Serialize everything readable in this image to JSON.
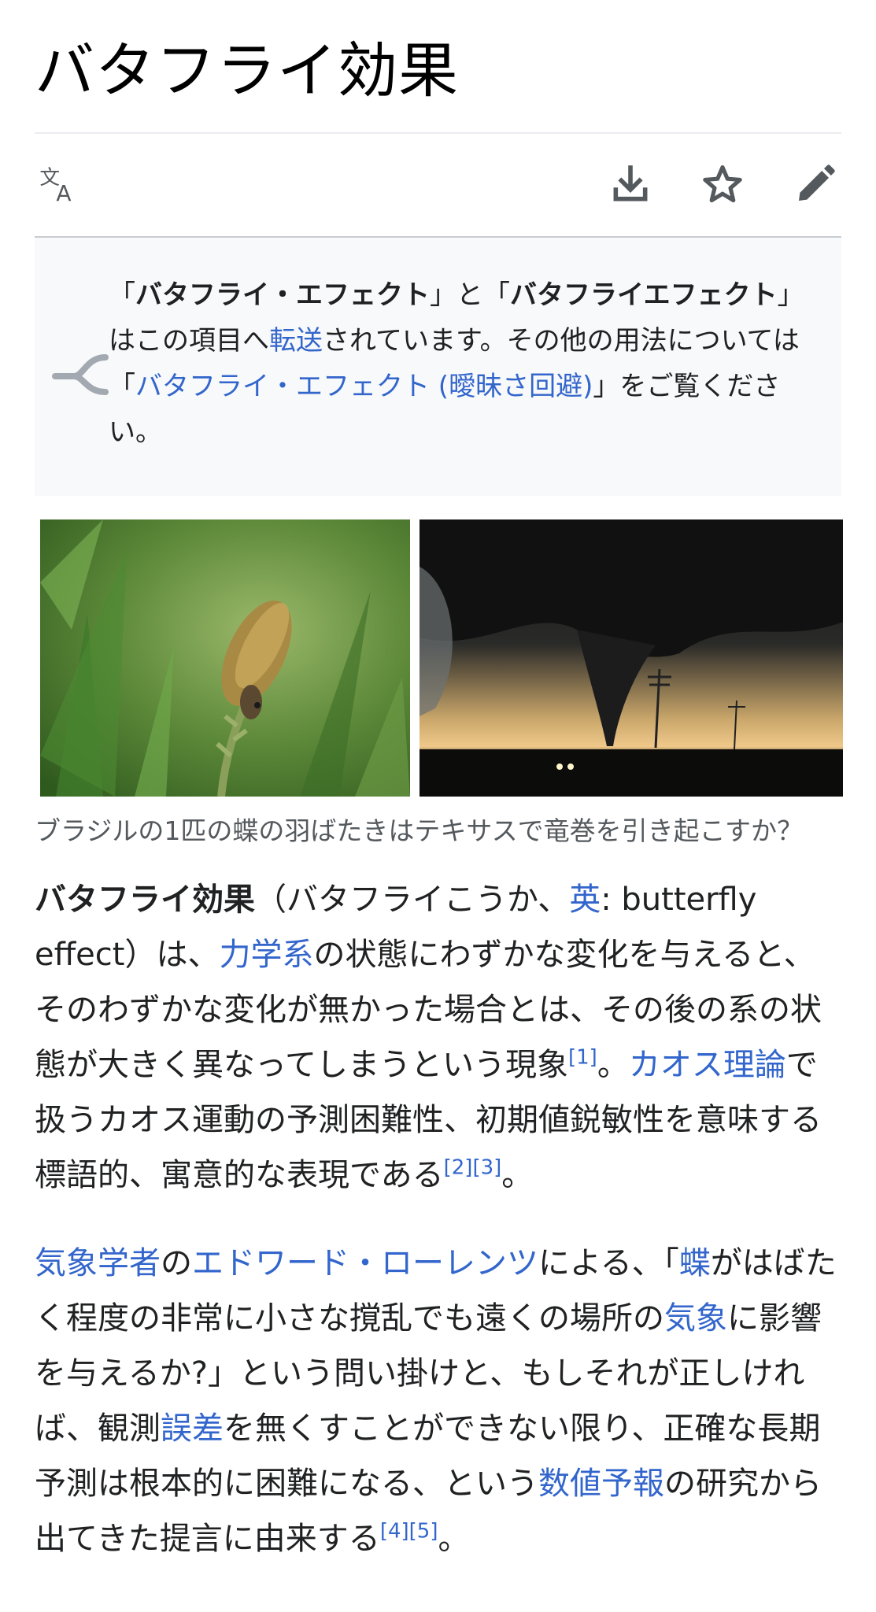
{
  "page": {
    "title": "バタフライ効果"
  },
  "toolbar": {
    "language_icon": "translate-icon",
    "download_icon": "download-icon",
    "watch_icon": "star-icon",
    "edit_icon": "pencil-icon"
  },
  "hatnote": {
    "icon": "redirect-icon",
    "q1_open": "「",
    "q1_bold": "バタフライ・エフェクト",
    "q1_close": "」と「",
    "q2_bold": "バタフライエフェクト",
    "q2_close": "」はこの項目へ",
    "link_redirect": "転送",
    "mid": "されています。その他の用法については「",
    "link_disambig": "バタフライ・エフェクト (曖昧さ回避)",
    "end": "」をご覧ください。"
  },
  "figure": {
    "caption": "ブラジルの1匹の蝶の羽ばたきはテキサスで竜巻を引き起こすか？"
  },
  "paragraph1": {
    "bold": "バタフライ効果",
    "t1": "（バタフライこうか、",
    "link_en": "英",
    "t2": ": butterfly effect）は、",
    "link_dynamics": "力学系",
    "t3": "の状態にわずかな変化を与えると、そのわずかな変化が無かった場合とは、その後の系の状態が大きく異なってしまうという現象",
    "ref1": "[1]",
    "t4": "。",
    "link_chaos": "カオス理論",
    "t5": "で扱うカオス運動の予測困難性、初期値鋭敏性を意味する標語的、寓意的な表現である",
    "ref2": "[2]",
    "ref3": "[3]",
    "t6": "。"
  },
  "paragraph2": {
    "link_meteorologist": "気象学者",
    "t1": "の",
    "link_lorenz": "エドワード・ローレンツ",
    "t2": "による、「",
    "link_butterfly": "蝶",
    "t3": "がはばたく程度の非常に小さな撹乱でも遠くの場所の",
    "link_weather": "気象",
    "t4": "に影響を与えるか?」という問い掛けと、もしそれが正しければ、観測",
    "link_error": "誤差",
    "t5": "を無くすことができない限り、正確な長期予測は根本的に困難になる、という",
    "link_nwp": "数値予報",
    "t6": "の研究から出てきた提言に由来する",
    "ref4": "[4]",
    "ref5": "[5]",
    "t7": "。"
  },
  "colors": {
    "link": "#3366cc",
    "text": "#202122",
    "hatnote_bg": "#f8f9fa",
    "caption": "#54595d"
  }
}
